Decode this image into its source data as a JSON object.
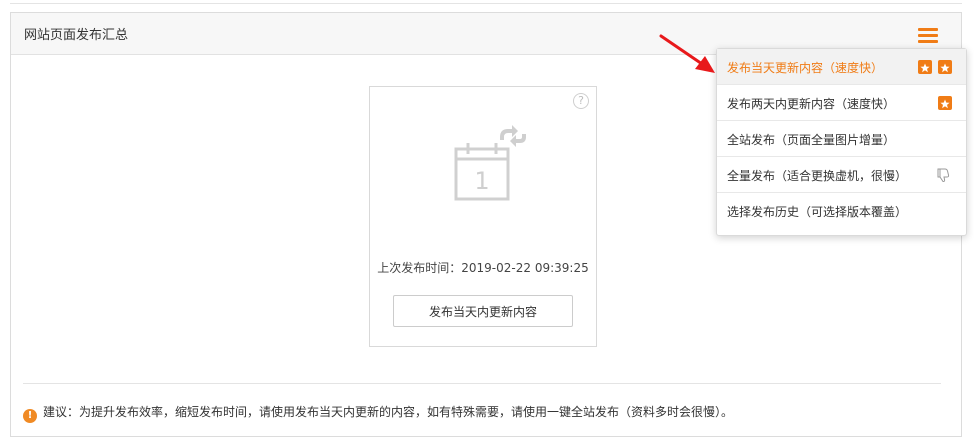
{
  "panel": {
    "title": "网站页面发布汇总"
  },
  "menu": {
    "icon": "hamburger-menu-icon"
  },
  "card": {
    "help_glyph": "?",
    "calendar_day": "1",
    "last_publish": "上次发布时间：2019-02-22 09:39:25",
    "publish_button": "发布当天内更新内容"
  },
  "advice": {
    "text": "建议：为提升发布效率，缩短发布时间，请使用发布当天内更新的内容，如有特殊需要，请使用一键全站发布（资料多时会很慢）。"
  },
  "dropdown": {
    "items": [
      {
        "label": "发布当天更新内容（速度快）",
        "badges": 2,
        "active": true
      },
      {
        "label": "发布两天内更新内容（速度快）",
        "badges": 1,
        "active": false
      },
      {
        "label": "全站发布（页面全量图片增量）",
        "badges": 0,
        "active": false
      },
      {
        "label": "全量发布（适合更换虚机，很慢）",
        "badges": 0,
        "thumb_down": true,
        "active": false
      },
      {
        "label": "选择发布历史（可选择版本覆盖）",
        "badges": 0,
        "active": false
      }
    ]
  },
  "colors": {
    "accent": "#f07c16",
    "warning": "#f08a24",
    "arrow": "#e8191b"
  }
}
